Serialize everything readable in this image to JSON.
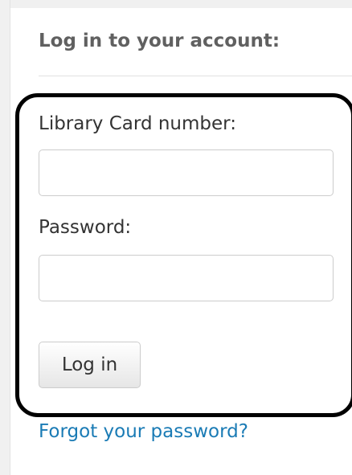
{
  "login": {
    "heading": "Log in to your account:",
    "card_label": "Library Card number:",
    "card_value": "",
    "password_label": "Password:",
    "password_value": "",
    "submit_label": "Log in",
    "forgot_link": "Forgot your password?"
  },
  "colors": {
    "heading": "#606060",
    "link": "#1a7bb5",
    "highlight_border": "#000000"
  }
}
